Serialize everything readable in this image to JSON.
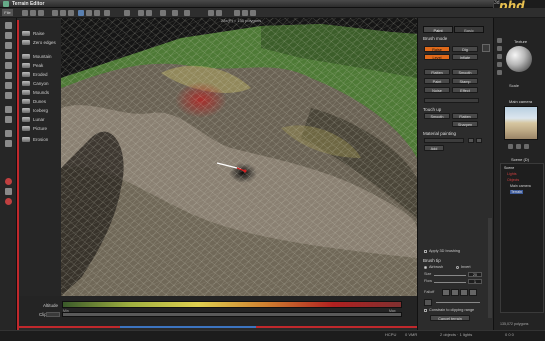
{
  "window": {
    "title": "Terrain Editor"
  },
  "logo": {
    "prefix": "3d",
    "text": "phd"
  },
  "menu": {
    "file": "File"
  },
  "viewport": {
    "info": "28x(P)  = 135 polygons"
  },
  "shapes": [
    {
      "label": "Raise"
    },
    {
      "label": "Zero edges"
    },
    {
      "label": "Mountain"
    },
    {
      "label": "Peak"
    },
    {
      "label": "Eroded"
    },
    {
      "label": "Canyon"
    },
    {
      "label": "Mounds"
    },
    {
      "label": "Dunes"
    },
    {
      "label": "Iceberg"
    },
    {
      "label": "Lunar"
    },
    {
      "label": "Picture"
    },
    {
      "label": "Erosion"
    }
  ],
  "altitude": {
    "label": "Altitude",
    "clip_label": "Clip",
    "min": "Min",
    "max": "Max"
  },
  "panel": {
    "tabs": {
      "paint": "Paint",
      "basic": "Basic"
    },
    "brush_mode": "Brush mode",
    "brush_buttons": [
      {
        "label": "Raise",
        "orange": true
      },
      {
        "label": "Dig",
        "orange": false
      },
      {
        "label": "Level",
        "orange": true
      },
      {
        "label": "Inflate",
        "orange": false
      },
      {
        "label": "Flatten",
        "orange": false
      },
      {
        "label": "Smooth",
        "orange": false
      },
      {
        "label": "Paint",
        "orange": false
      },
      {
        "label": "Stamp",
        "orange": false
      },
      {
        "label": "Noise",
        "orange": false
      },
      {
        "label": "Effect",
        "orange": false
      }
    ],
    "touchup": "Touch up",
    "touchup_buttons": [
      {
        "label": "Smooth"
      },
      {
        "label": "Flatten"
      },
      {
        "label": "Sharpen"
      }
    ],
    "material_painting": "Material painting",
    "add_label": "Add",
    "apply_3d": "Apply 3D brushing",
    "brush_tip": "Brush tip",
    "radio_a": "Airbrush",
    "radio_b": "Invert",
    "size_label": "Size",
    "flow_label": "Flow",
    "falloff_label": "Falloff",
    "size_value": "20",
    "flow_value": "1",
    "constrain": "Constrain to clipping range",
    "cancel": "Cancel terrain"
  },
  "side": {
    "texture_title": "Texture",
    "scale_label": "Scale",
    "main_camera": "Main camera",
    "scene_title": "Scene (D)",
    "scene_rows": [
      {
        "label": "Scene",
        "color": "#e0e0e0"
      },
      {
        "label": "Lights",
        "color": "#d04040"
      },
      {
        "label": "Objects",
        "color": "#d04040"
      },
      {
        "label": "Main camera",
        "color": "#d0d0d0"
      },
      {
        "label": "Terrain",
        "color": "#e0e0e0"
      }
    ],
    "poly_count": "135,072 polygons"
  },
  "status": {
    "a": "HCPU",
    "b": "0 VMR",
    "c": "2 objects · 1 lights",
    "d": "0 0 0"
  }
}
